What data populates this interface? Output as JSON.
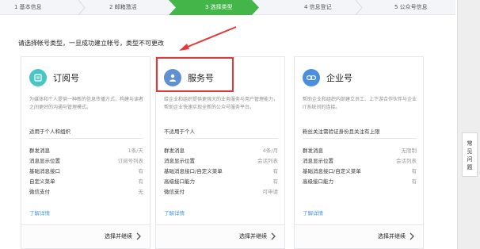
{
  "steps": [
    {
      "label": "1 基本信息",
      "active": false
    },
    {
      "label": "2 邮箱激活",
      "active": false
    },
    {
      "label": "3 选择类型",
      "active": true
    },
    {
      "label": "4 信息登记",
      "active": false
    },
    {
      "label": "5 公众号信息",
      "active": false
    }
  ],
  "notice": "请选择帐号类型，一旦成功建立帐号，类型不可更改",
  "side_help_label": "常见问题",
  "colors": {
    "accent": "#44b549",
    "link": "#459ae9",
    "highlight": "#e5383b"
  },
  "cards": [
    {
      "name": "订阅号",
      "icon": "subscription-icon",
      "icon_color": "#49c5c2",
      "desc": "为媒体和个人提供一种新的信息传播方式，构建与读者之间更好的沟通与管理模式。",
      "target": "适用于个人和组织",
      "features": [
        {
          "key": "群发消息",
          "value": "1条/天"
        },
        {
          "key": "消息显示位置",
          "value": "订阅号列表"
        },
        {
          "key": "基础消息接口",
          "value": "有"
        },
        {
          "key": "自定义菜单",
          "value": "有"
        },
        {
          "key": "微信支付",
          "value": "无"
        }
      ],
      "more": "了解详情",
      "choose": "选择并继续"
    },
    {
      "name": "服务号",
      "icon": "service-icon",
      "icon_color": "#5f90d1",
      "desc": "给企业和组织提供更强大的业务服务与用户管理能力，帮助企业快速实现全新的公众号服务平台。",
      "target": "不适用于个人",
      "features": [
        {
          "key": "群发消息",
          "value": "4条/月"
        },
        {
          "key": "消息显示位置",
          "value": "会话列表"
        },
        {
          "key": "基础消息接口/自定义菜单",
          "value": "有"
        },
        {
          "key": "高级接口能力",
          "value": "有"
        },
        {
          "key": "微信支付",
          "value": "可申请"
        }
      ],
      "more": "了解详情",
      "choose": "选择并继续"
    },
    {
      "name": "企业号",
      "icon": "enterprise-icon",
      "icon_color": "#4a8ee0",
      "desc": "帮助企业和组织内部建立员工、上下游合作伙伴与企业IT系统间的连接。",
      "target": "粉丝关注需验证身份且关注有上限",
      "features": [
        {
          "key": "群发消息",
          "value": "无限制"
        },
        {
          "key": "消息显示位置",
          "value": "会话列表"
        },
        {
          "key": "基础消息接口/自定义菜单",
          "value": "有"
        },
        {
          "key": "高级接口能力",
          "value": "有"
        }
      ],
      "more": "了解详情",
      "choose": "选择并继续"
    }
  ]
}
